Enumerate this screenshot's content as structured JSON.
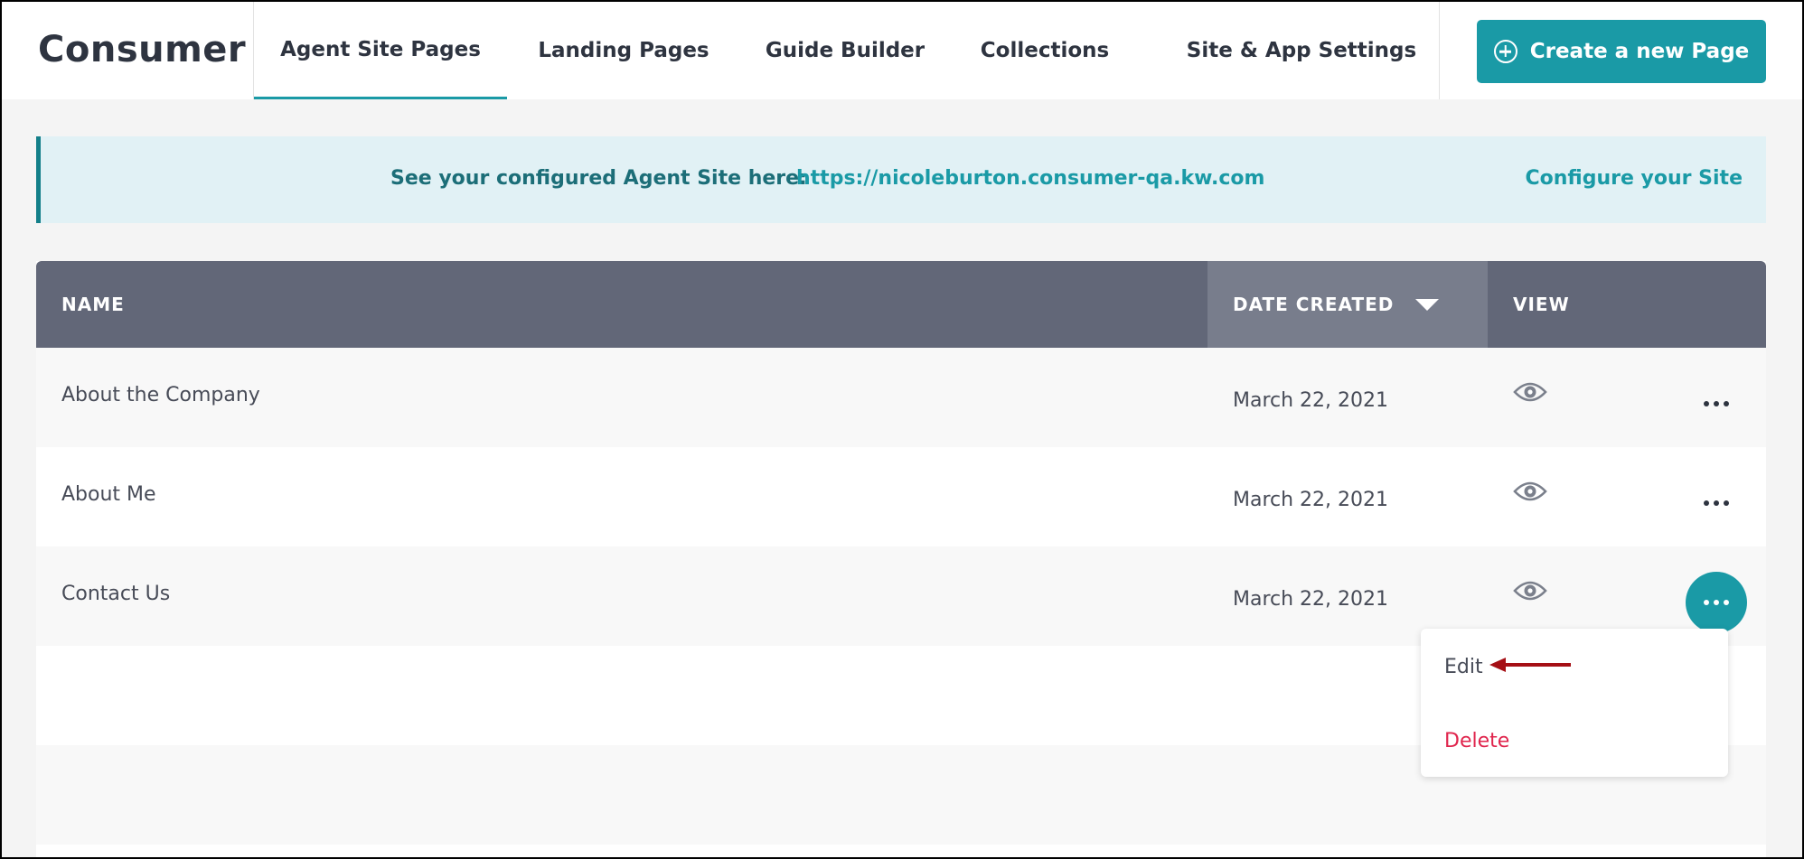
{
  "header": {
    "app_title": "Consumer",
    "tabs": [
      {
        "label": "Agent Site Pages",
        "active": true
      },
      {
        "label": "Landing Pages",
        "active": false
      },
      {
        "label": "Guide Builder",
        "active": false
      },
      {
        "label": "Collections",
        "active": false
      },
      {
        "label": "Site & App Settings",
        "active": false
      }
    ],
    "create_button": {
      "label": "Create a new Page",
      "icon": "plus-circle-icon"
    }
  },
  "banner": {
    "text": "See your configured Agent Site here:",
    "link": "https://nicoleburton.consumer-qa.kw.com",
    "configure_label": "Configure your Site"
  },
  "table": {
    "columns": {
      "name": "NAME",
      "date_created": "DATE CREATED",
      "view": "VIEW"
    },
    "sort": {
      "column": "date_created",
      "direction": "descending"
    },
    "rows": [
      {
        "name": "About the Company",
        "date_created": "March 22, 2021"
      },
      {
        "name": "About Me",
        "date_created": "March 22, 2021"
      },
      {
        "name": "Contact Us",
        "date_created": "March 22, 2021",
        "menu_open": true
      }
    ]
  },
  "row_menu": {
    "edit_label": "Edit",
    "delete_label": "Delete"
  },
  "colors": {
    "accent": "#1a9aa6",
    "header_bar": "#626778",
    "banner_bg": "#e1f1f5",
    "delete": "#e0254d",
    "annotation_arrow": "#a50f15"
  }
}
